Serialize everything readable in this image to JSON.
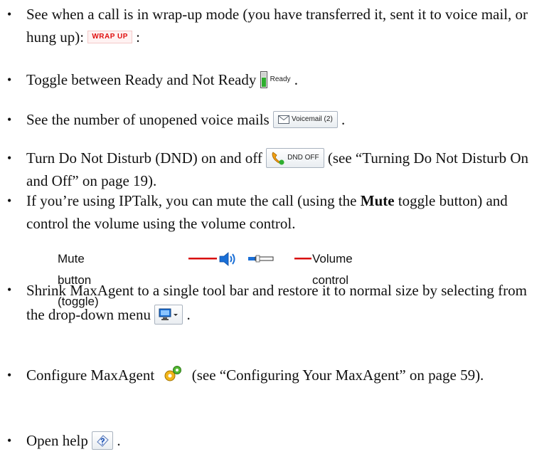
{
  "items": [
    {
      "bullet": "•",
      "text_before": "See when a call is in wrap-up mode (you have transferred it, sent it to voice mail, or hung up):",
      "badge": "WRAP UP",
      "text_after": ":"
    },
    {
      "bullet": "•",
      "text_before": "Toggle between Ready and Not Ready",
      "badge": "Ready",
      "text_after": "."
    },
    {
      "bullet": "•",
      "text_before": "See the number of unopened voice mails",
      "badge": "Voicemail (2)",
      "text_after": "."
    },
    {
      "bullet": "•",
      "text_before": "Turn Do Not Disturb (DND) on and off",
      "badge": "DND OFF",
      "text_after": "(see “Turning Do Not Disturb On and Off” on page 19)."
    },
    {
      "bullet": "•",
      "text_before": "If you’re using IPTalk, you can mute the call (using the",
      "bold": "Mute",
      "text_after": "toggle button) and control the volume using the volume control."
    },
    {
      "bullet": "•",
      "text_before": "Shrink MaxAgent to a single tool bar and restore it to normal size by selecting from the drop-down menu",
      "text_after": "."
    },
    {
      "bullet": "•",
      "text_before": "Configure MaxAgent",
      "text_after": "(see “Configuring Your MaxAgent” on page 59)."
    },
    {
      "bullet": "•",
      "text_before": "Open help",
      "text_after": "."
    }
  ],
  "figure": {
    "mute_label": "Mute button (toggle)",
    "volume_label": "Volume control"
  },
  "icons": {
    "ready": "ready-status-icon",
    "voicemail": "envelope-icon",
    "dnd": "phone-handset-icon",
    "mute": "speaker-icon",
    "volume": "volume-slider-icon",
    "dropdown": "monitor-dropdown-icon",
    "configure": "gears-icon",
    "help": "help-icon"
  },
  "colors": {
    "wrapup_red": "#e01010",
    "line_red": "#d81010",
    "ready_green": "#2fae2f",
    "volume_blue": "#1a6fd6"
  }
}
